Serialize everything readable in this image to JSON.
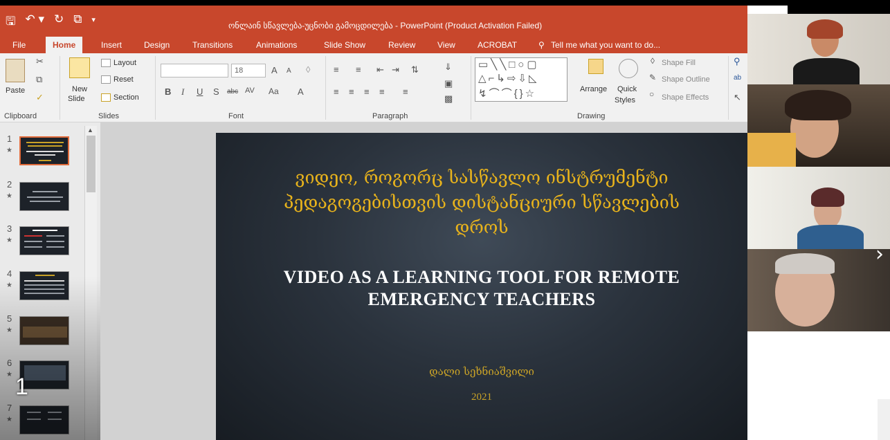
{
  "window": {
    "title": "ონლაინ სწავლება-უცნობი გამოცდილება - PowerPoint (Product Activation Failed)"
  },
  "qat": {
    "save_glyph": "🖫",
    "undo_glyph": "↶ ▾",
    "redo_glyph": "↻",
    "present_glyph": "⧉",
    "more_glyph": "▾"
  },
  "tabs": [
    {
      "label": "File"
    },
    {
      "label": "Home"
    },
    {
      "label": "Insert"
    },
    {
      "label": "Design"
    },
    {
      "label": "Transitions"
    },
    {
      "label": "Animations"
    },
    {
      "label": "Slide Show"
    },
    {
      "label": "Review"
    },
    {
      "label": "View"
    },
    {
      "label": "ACROBAT"
    }
  ],
  "tell_me": "Tell me what you want to do...",
  "ribbon": {
    "clipboard": {
      "paste": "Paste",
      "group": "Clipboard"
    },
    "slides": {
      "new_slide": "New",
      "new_slide2": "Slide",
      "layout": "Layout",
      "reset": "Reset",
      "section": "Section",
      "group": "Slides"
    },
    "font": {
      "size": "18",
      "bold": "B",
      "italic": "I",
      "underline": "U",
      "shadow": "S",
      "strike": "abc",
      "spacing": "AV",
      "case": "Aa",
      "color": "A",
      "grow": "A",
      "shrink": "A",
      "group": "Font"
    },
    "paragraph": {
      "group": "Paragraph"
    },
    "drawing": {
      "arrange": "Arrange",
      "quick_styles": "Quick",
      "quick_styles2": "Styles",
      "shape_fill": "Shape Fill",
      "shape_outline": "Shape Outline",
      "shape_effects": "Shape Effects",
      "group": "Drawing"
    }
  },
  "thumbnails": [
    {
      "num": "1"
    },
    {
      "num": "2"
    },
    {
      "num": "3"
    },
    {
      "num": "4"
    },
    {
      "num": "5"
    },
    {
      "num": "6"
    },
    {
      "num": "7"
    }
  ],
  "slide_counter": "1",
  "slide": {
    "georgian_title": [
      "ვიდეო, როგორც სასწავლო ინსტრუმენტი",
      "პედაგოგებისთვის დისტანციური სწავლების",
      "დროს"
    ],
    "english_title": [
      "VIDEO AS A LEARNING TOOL FOR REMOTE",
      "EMERGENCY TEACHERS"
    ],
    "author": "დალი სეხნიაშვილი",
    "year": "2021"
  },
  "colors": {
    "accent": "#c8472c",
    "slide_gold": "#e8b31c"
  },
  "icons": {
    "next": "›"
  }
}
